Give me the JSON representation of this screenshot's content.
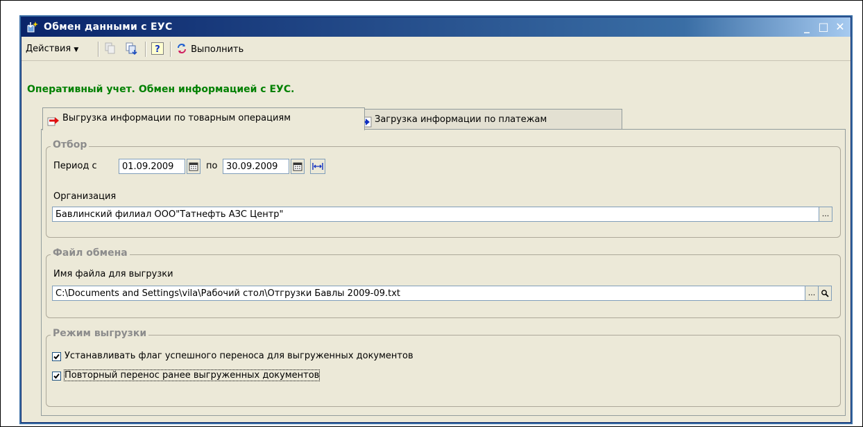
{
  "window": {
    "title": "Обмен данными с ЕУС",
    "controls": {
      "minimize": "_",
      "maximize": "□",
      "close": "✕"
    }
  },
  "toolbar": {
    "actions_label": "Действия",
    "execute_label": "Выполнить",
    "help_glyph": "?"
  },
  "header": {
    "title": "Оперативный учет. Обмен информацией с ЕУС."
  },
  "tabs": [
    {
      "label": "Выгрузка информации по товарным операциям",
      "active": true,
      "icon": "arrow-right-red-icon"
    },
    {
      "label": "Загрузка информации по платежам",
      "active": false,
      "icon": "arrow-right-blue-icon"
    }
  ],
  "filter_group": {
    "title": "Отбор",
    "period_from_label": "Период с",
    "period_from_value": "01.09.2009",
    "period_to_label": "по",
    "period_to_value": "30.09.2009",
    "organization_label": "Организация",
    "organization_value": "Бавлинский филиал ООО\"Татнефть АЗС Центр\"",
    "ellipsis": "..."
  },
  "file_group": {
    "title": "Файл обмена",
    "filename_label": "Имя файла для выгрузки",
    "filename_value": "C:\\Documents and Settings\\vila\\Рабочий стол\\Отгрузки Бавлы 2009-09.txt",
    "ellipsis": "..."
  },
  "mode_group": {
    "title": "Режим выгрузки",
    "options": [
      {
        "label": "Устанавливать флаг успешного переноса для выгруженных документов",
        "checked": true
      },
      {
        "label": "Повторный перенос ранее выгруженных документов",
        "checked": true
      }
    ]
  },
  "colors": {
    "title_bar_start": "#0a246a",
    "title_bar_end": "#a6caf0",
    "header_green": "#008000",
    "window_bg": "#ece9d8"
  }
}
